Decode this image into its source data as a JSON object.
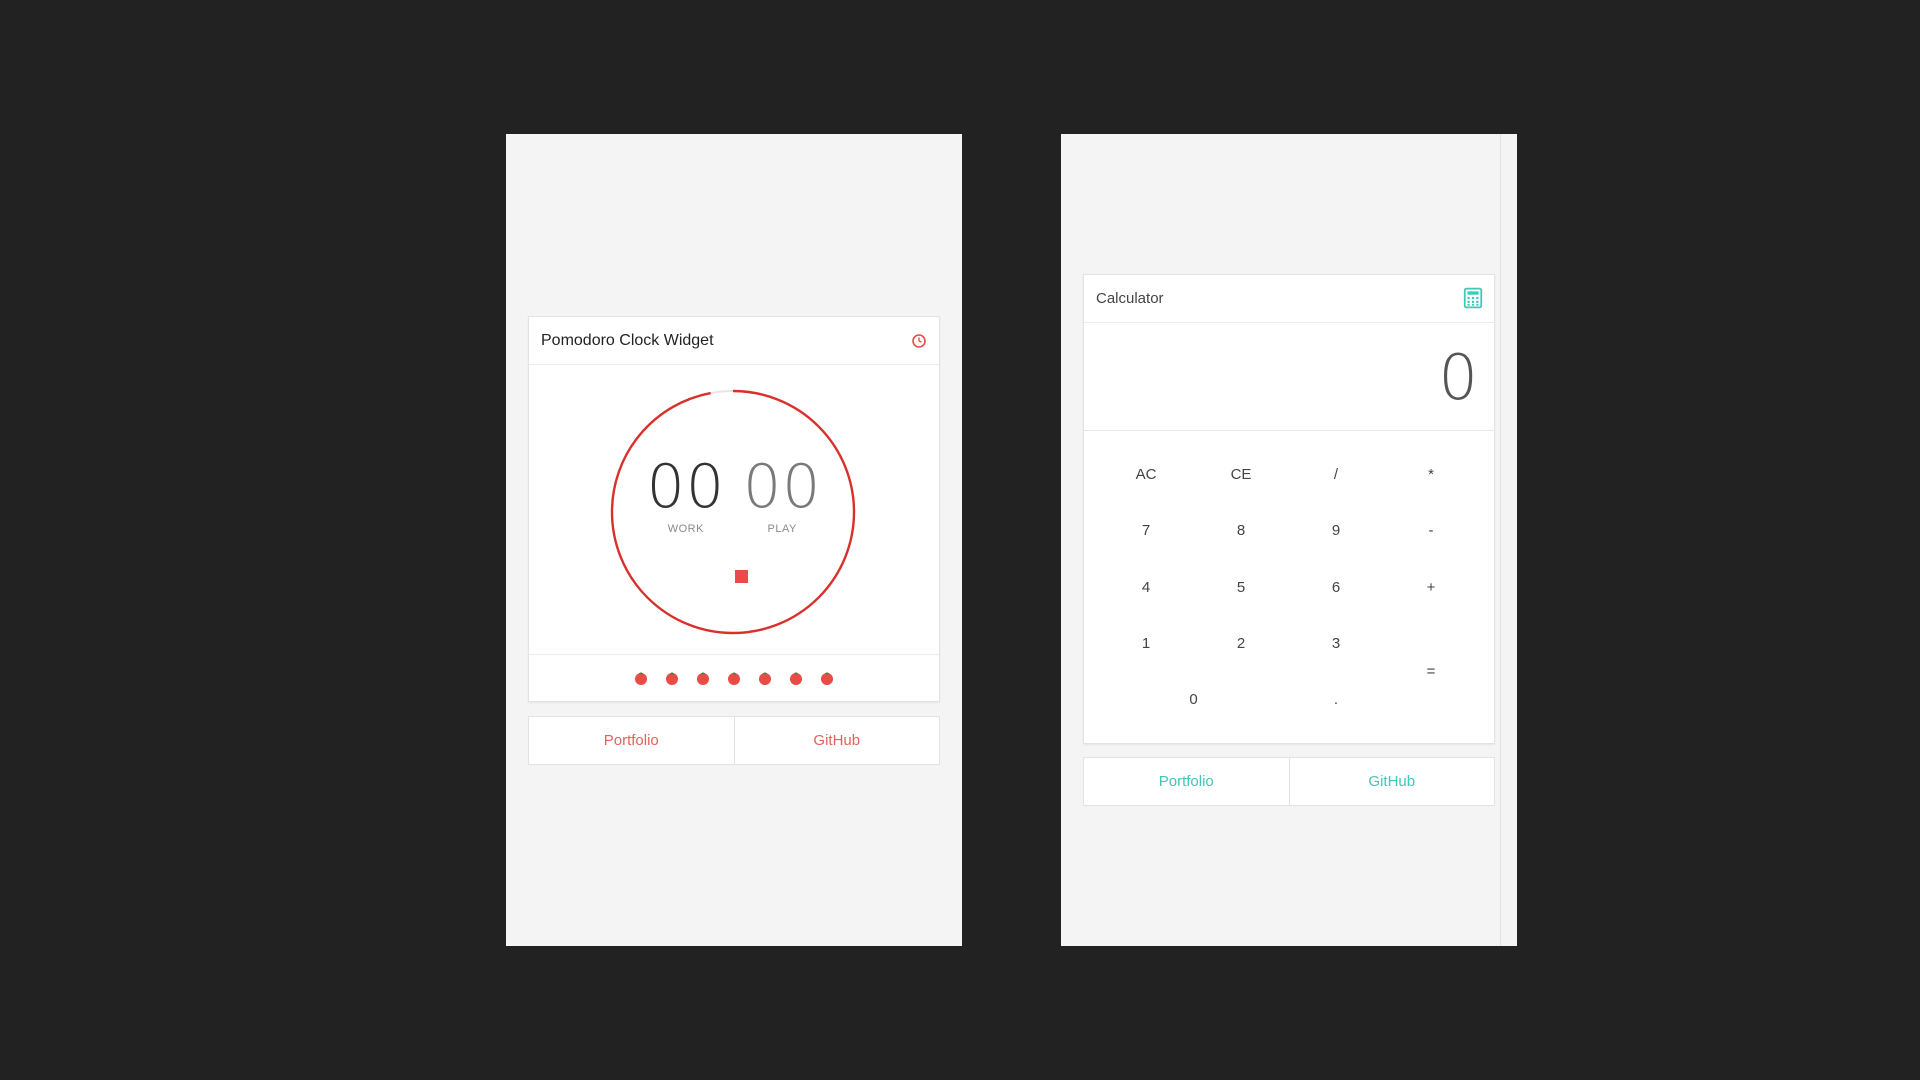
{
  "pomodoro": {
    "title": "Pomodoro Clock Widget",
    "header_icon": "timer-icon",
    "work_value": "00",
    "play_value": "00",
    "work_label": "WORK",
    "play_label": "PLAY",
    "progress_fraction": 0.97,
    "stop_icon": "stop-icon",
    "tomato_count": 7,
    "accent_color": "#ea4b46",
    "links": {
      "portfolio": "Portfolio",
      "github": "GitHub"
    }
  },
  "calculator": {
    "title": "Calculator",
    "header_icon": "calculator-icon",
    "display_value": "0",
    "accent_color": "#3ec8b6",
    "keys": {
      "ac": "AC",
      "ce": "CE",
      "divide": "/",
      "multiply": "*",
      "seven": "7",
      "eight": "8",
      "nine": "9",
      "minus": "-",
      "four": "4",
      "five": "5",
      "six": "6",
      "plus": "+",
      "one": "1",
      "two": "2",
      "three": "3",
      "equals": "=",
      "zero": "0",
      "decimal": "."
    },
    "links": {
      "portfolio": "Portfolio",
      "github": "GitHub"
    }
  }
}
